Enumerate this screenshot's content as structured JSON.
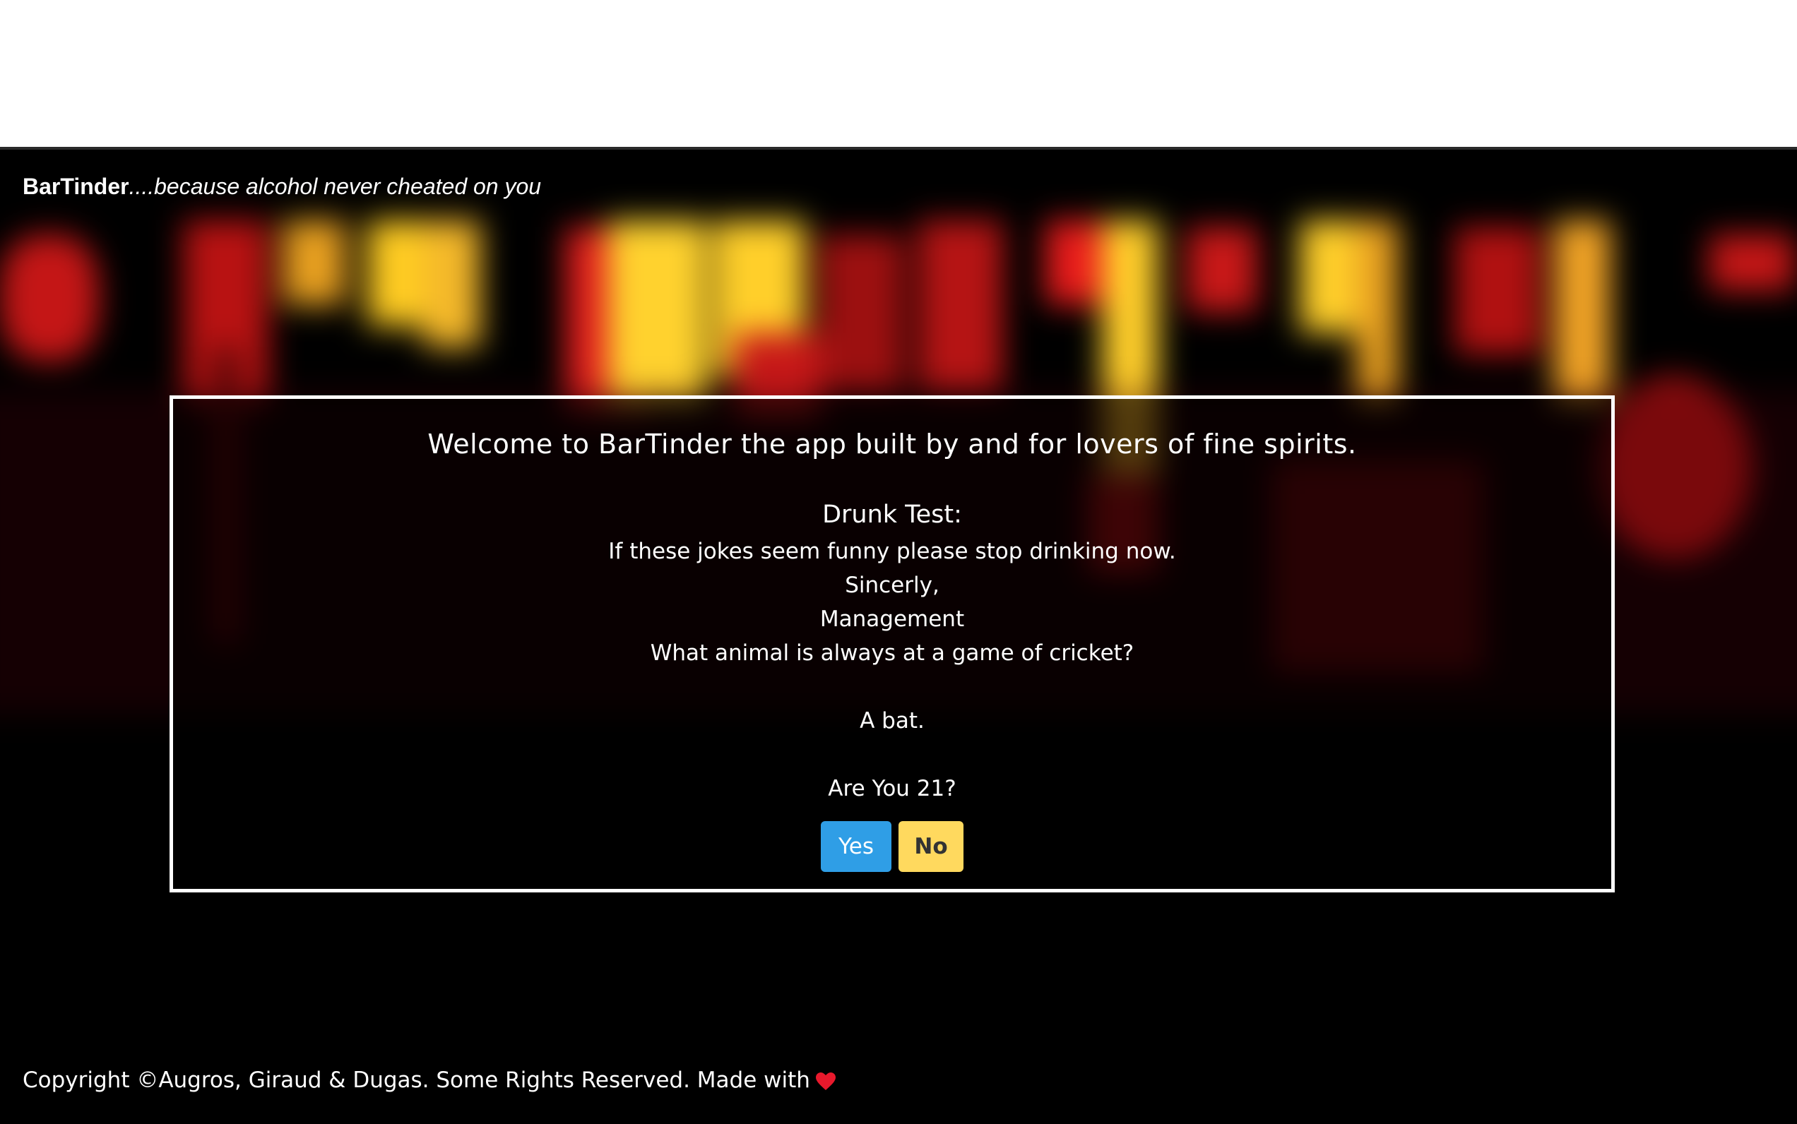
{
  "header": {
    "brand_name": "BarTinder",
    "tagline": "....because alcohol never cheated on you"
  },
  "panel": {
    "welcome": "Welcome to BarTinder the app built by and for lovers of fine spirits.",
    "drunk_test_title": "Drunk Test:",
    "lines": [
      "If these jokes seem funny please stop drinking now.",
      "Sincerly,",
      "Management",
      "What animal is always at a game of cricket?",
      "A bat.",
      "Are You 21?"
    ],
    "yes_label": "Yes",
    "no_label": "No"
  },
  "footer": {
    "copyright": "Copyright ©Augros, Giraud & Dugas. Some Rights Reserved. Made with",
    "heart_icon": "heart-icon"
  },
  "colors": {
    "yes_button": "#2f9ee6",
    "no_button": "#ffd95e",
    "heart": "#e8192c",
    "background": "#000000"
  }
}
